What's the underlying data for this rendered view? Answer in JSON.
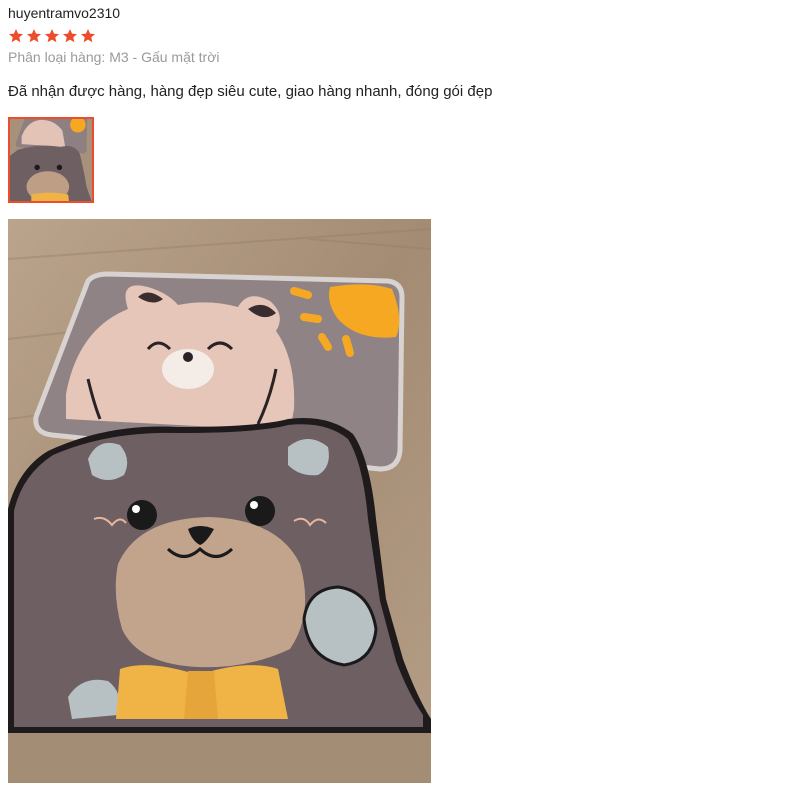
{
  "review": {
    "username": "huyentramvo2310",
    "rating": 5,
    "rating_max": 5,
    "variation": "Phân loại hàng: M3 - Gấu mặt trời",
    "comment": "Đã nhận được hàng, hàng đẹp siêu cute, giao hàng nhanh, đóng gói đẹp"
  },
  "media": {
    "thumbnail_icon": "bear-rug-photo-thumbnail",
    "photo_icon": "bear-rug-photo"
  },
  "colors": {
    "star": "#ee4d2d",
    "thumb_border": "#ee4d2d",
    "variation_text": "#9a9a9a"
  }
}
